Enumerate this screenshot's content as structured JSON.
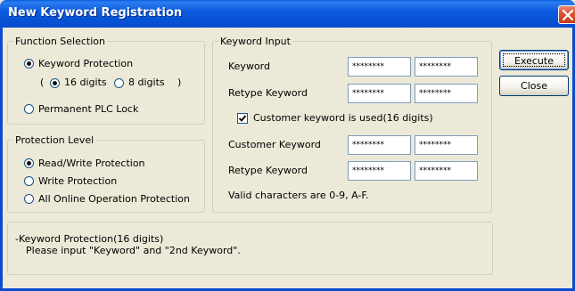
{
  "window": {
    "title": "New Keyword Registration"
  },
  "function_selection": {
    "legend": "Function Selection",
    "keyword_protection": {
      "label": "Keyword Protection",
      "selected": true
    },
    "digits_open": "(",
    "digits_close": ")",
    "digits_16": {
      "label": "16 digits",
      "selected": true
    },
    "digits_8": {
      "label": "8 digits",
      "selected": false
    },
    "permanent_lock": {
      "label": "Permanent PLC Lock",
      "selected": false
    }
  },
  "protection_level": {
    "legend": "Protection Level",
    "read_write": {
      "label": "Read/Write Protection",
      "selected": true
    },
    "write": {
      "label": "Write Protection",
      "selected": false
    },
    "online_ops": {
      "label": "All Online Operation Protection",
      "selected": false
    }
  },
  "keyword_input": {
    "legend": "Keyword Input",
    "keyword_label": "Keyword",
    "keyword_part1": "********",
    "keyword_part2": "********",
    "retype_label": "Retype Keyword",
    "retype_part1": "********",
    "retype_part2": "********",
    "customer_checkbox": {
      "label": "Customer keyword is used(16 digits)",
      "checked": true
    },
    "customer_label": "Customer Keyword",
    "customer_part1": "********",
    "customer_part2": "********",
    "customer_retype_label": "Retype Keyword",
    "customer_retype_part1": "********",
    "customer_retype_part2": "********",
    "valid_chars": "Valid characters are 0-9, A-F."
  },
  "buttons": {
    "execute": "Execute",
    "close": "Close"
  },
  "description": {
    "line1": "-Keyword Protection(16 digits)",
    "line2": "Please input \"Keyword\" and \"2nd Keyword\"."
  },
  "colors": {
    "titlebar": "#0a4bcf",
    "dialog_bg": "#ece9d8",
    "radio_selected": "#21a121",
    "close_button": "#d4502c"
  }
}
